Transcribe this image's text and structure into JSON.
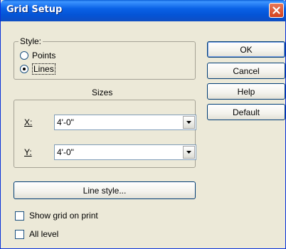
{
  "window": {
    "title": "Grid Setup"
  },
  "style_group": {
    "legend": "Style:",
    "options": [
      {
        "label": "Points",
        "selected": false
      },
      {
        "label": "Lines",
        "selected": true
      }
    ]
  },
  "sizes": {
    "heading": "Sizes",
    "x": {
      "label": "X:",
      "value": "4'-0\""
    },
    "y": {
      "label": "Y:",
      "value": "4'-0\""
    }
  },
  "buttons": {
    "ok": "OK",
    "cancel": "Cancel",
    "help": "Help",
    "default": "Default",
    "line_style": "Line style..."
  },
  "checkboxes": {
    "show_grid_on_print": {
      "label": "Show grid on print",
      "checked": false
    },
    "all_level": {
      "label": "All level",
      "checked": false
    }
  }
}
